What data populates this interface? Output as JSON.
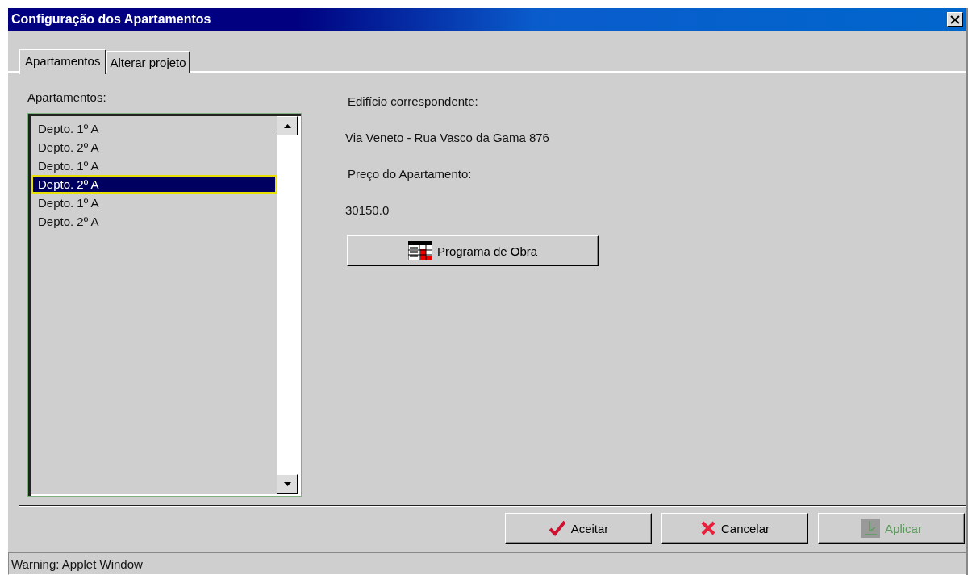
{
  "window": {
    "title": "Configuração dos Apartamentos"
  },
  "tabs": [
    {
      "label": "Apartamentos",
      "selected": true
    },
    {
      "label": "Alterar projeto",
      "selected": false
    }
  ],
  "list": {
    "label": "Apartamentos:",
    "items": [
      {
        "label": "Depto. 1º A",
        "selected": false
      },
      {
        "label": "Depto. 2º A",
        "selected": false
      },
      {
        "label": "Depto. 1º A",
        "selected": false
      },
      {
        "label": "Depto. 2º A",
        "selected": true
      },
      {
        "label": "Depto. 1º A",
        "selected": false
      },
      {
        "label": "Depto. 2º A",
        "selected": false
      }
    ]
  },
  "details": {
    "building_label": "Edifício correspondente:",
    "building": "Via Veneto - Rua Vasco da Gama 876",
    "price_label": "Preço do Apartamento:",
    "price": "30150.0",
    "program_button": "Programa de Obra"
  },
  "buttons": [
    {
      "kind": "accept",
      "label": "Aceitar",
      "disabled": false
    },
    {
      "kind": "cancel",
      "label": "Cancelar",
      "disabled": false
    },
    {
      "kind": "apply",
      "label": "Aplicar",
      "disabled": true
    }
  ],
  "status_bar": "Warning: Applet Window"
}
